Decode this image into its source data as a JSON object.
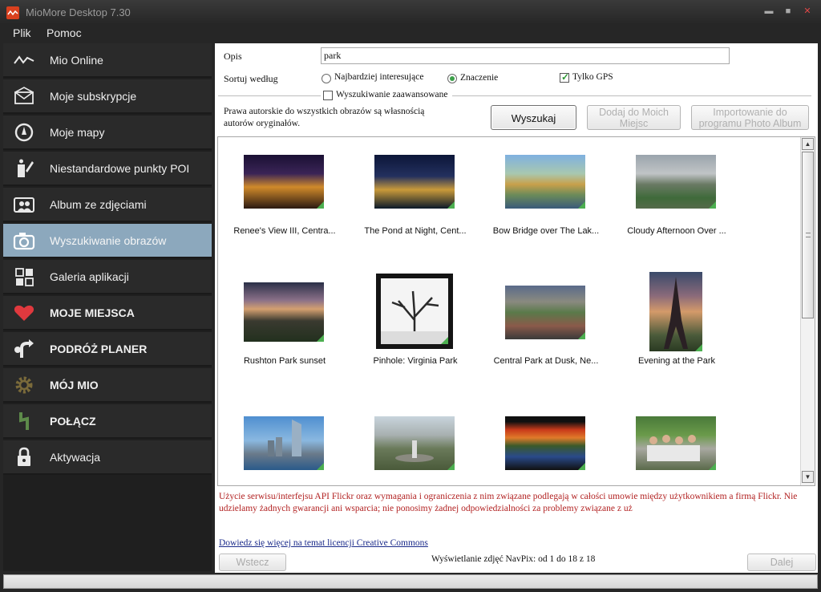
{
  "window": {
    "title": "MioMore Desktop 7.30",
    "minimize": "▬",
    "maximize": "■",
    "close": "✕"
  },
  "menu": {
    "file": "Plik",
    "help": "Pomoc"
  },
  "sidebar": {
    "items": [
      {
        "label": "Mio Online",
        "icon": "wave-icon"
      },
      {
        "label": "Moje subskrypcje",
        "icon": "envelope-icon"
      },
      {
        "label": "Moje mapy",
        "icon": "compass-icon"
      },
      {
        "label": "Niestandardowe punkty POI",
        "icon": "edit-poi-icon"
      },
      {
        "label": "Album ze zdjęciami",
        "icon": "photo-album-icon"
      },
      {
        "label": "Wyszukiwanie obrazów",
        "icon": "camera-icon",
        "active": true
      },
      {
        "label": "Galeria aplikacji",
        "icon": "grid-icon"
      },
      {
        "label": "MOJE MIEJSCA",
        "icon": "heart-icon"
      },
      {
        "label": "PODRÓŻ PLANER",
        "icon": "route-icon"
      },
      {
        "label": "MÓJ MIO",
        "icon": "gear-icon"
      },
      {
        "label": "POŁĄCZ",
        "icon": "connect-icon"
      },
      {
        "label": "Aktywacja",
        "icon": "lock-icon"
      }
    ],
    "accent_active": "#8ca8bd",
    "heart_color": "#e0393e"
  },
  "search": {
    "description_label": "Opis",
    "description_value": "park",
    "sort_label": "Sortuj według",
    "sort_options": [
      "Najbardziej interesujące",
      "Znaczenie"
    ],
    "sort_selected": "Znaczenie",
    "gps_only_label": "Tylko GPS",
    "gps_only_checked": true,
    "advanced_label": "Wyszukiwanie zaawansowane",
    "advanced_checked": false,
    "copyright": "Prawa autorskie do wszystkich obrazów są własnością autorów oryginałów.",
    "search_button": "Wyszukaj",
    "add_button": [
      "Dodaj do Moich",
      "Miejsc"
    ],
    "import_button": [
      "Importowanie do",
      "programu Photo Album"
    ]
  },
  "results": [
    {
      "caption": "Renee's View III, Centra...",
      "scene": "city-night"
    },
    {
      "caption": "The Pond at Night, Cent...",
      "scene": "pond-night"
    },
    {
      "caption": "Bow Bridge over The Lak...",
      "scene": "bridge"
    },
    {
      "caption": "Cloudy Afternoon Over ...",
      "scene": "cloudy-city"
    },
    {
      "caption": "Rushton Park sunset",
      "scene": "sunset"
    },
    {
      "caption": "Pinhole: Virginia Park",
      "scene": "pinhole"
    },
    {
      "caption": "Central Park at Dusk, Ne...",
      "scene": "dusk"
    },
    {
      "caption": "Evening at the Park",
      "scene": "eiffel"
    },
    {
      "caption": "",
      "scene": "skyscraper"
    },
    {
      "caption": "",
      "scene": "fountain"
    },
    {
      "caption": "",
      "scene": "autumn"
    },
    {
      "caption": "",
      "scene": "group"
    }
  ],
  "disclaimer": "Użycie serwisu/interfejsu API Flickr oraz wymagania i ograniczenia z nim związane podlegają w całości umowie między użytkownikiem a firmą Flickr. Nie udzielamy żadnych gwarancji ani wsparcia; nie ponosimy żadnej odpowiedzialności za problemy związane z uż",
  "cc_link": "Dowiedz się więcej na temat licencji Creative Commons",
  "footer": {
    "back": "Wstecz",
    "status": "Wyświetlanie zdjęć NavPix: od 1 do 18 z 18",
    "next": "Dalej"
  }
}
